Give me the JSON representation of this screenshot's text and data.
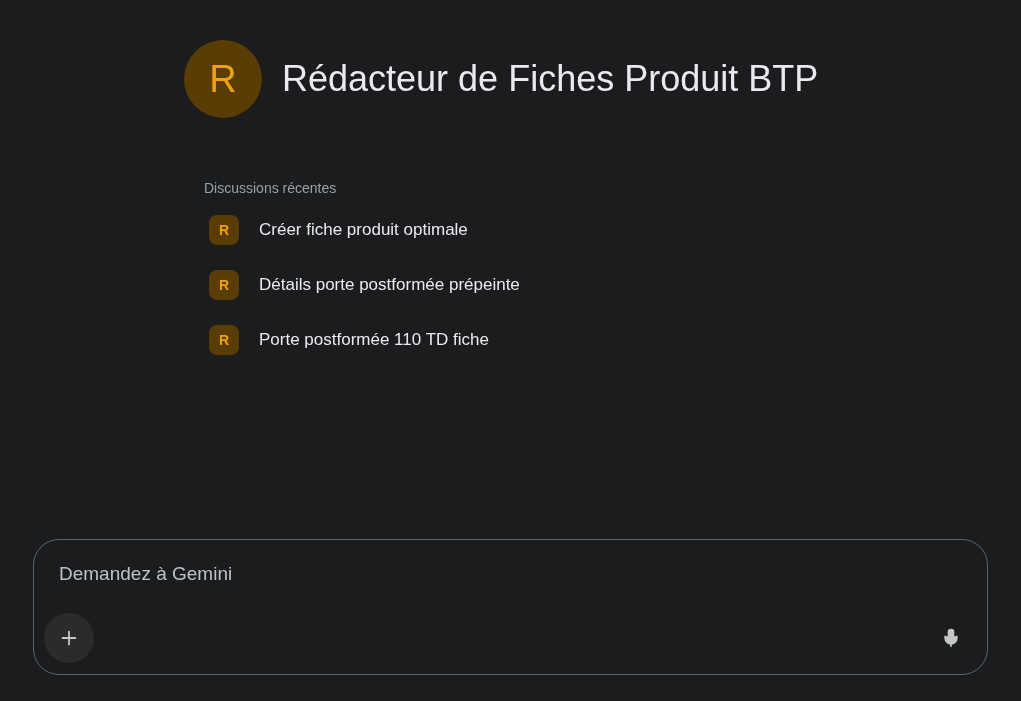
{
  "header": {
    "avatar_letter": "R",
    "title": "Rédacteur de Fiches Produit BTP"
  },
  "recent": {
    "heading": "Discussions récentes",
    "items": [
      {
        "icon_letter": "R",
        "label": "Créer fiche produit optimale"
      },
      {
        "icon_letter": "R",
        "label": "Détails porte postformée prépeinte"
      },
      {
        "icon_letter": "R",
        "label": "Porte postformée 110 TD fiche"
      }
    ]
  },
  "composer": {
    "placeholder": "Demandez à Gemini"
  }
}
